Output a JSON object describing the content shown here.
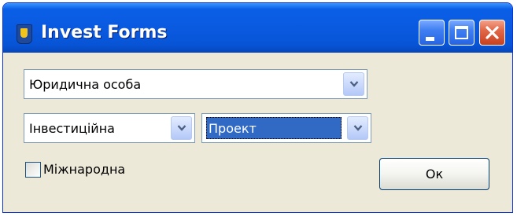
{
  "window": {
    "title": "Invest Forms",
    "controls": {
      "minimize_icon": "minimize-icon",
      "maximize_icon": "maximize-icon",
      "close_icon": "close-icon"
    }
  },
  "form": {
    "entity_type": {
      "value": "Юридична особа"
    },
    "investment_kind": {
      "value": "Інвестиційна"
    },
    "project": {
      "value": "Проект"
    },
    "international": {
      "label": "Міжнародна",
      "checked": false
    },
    "ok_button": {
      "label": "Ок"
    }
  },
  "colors": {
    "titlebar": "#0a5ae0",
    "window_bg": "#ece9d8",
    "selection": "#316ac5",
    "close_button": "#e26848"
  }
}
